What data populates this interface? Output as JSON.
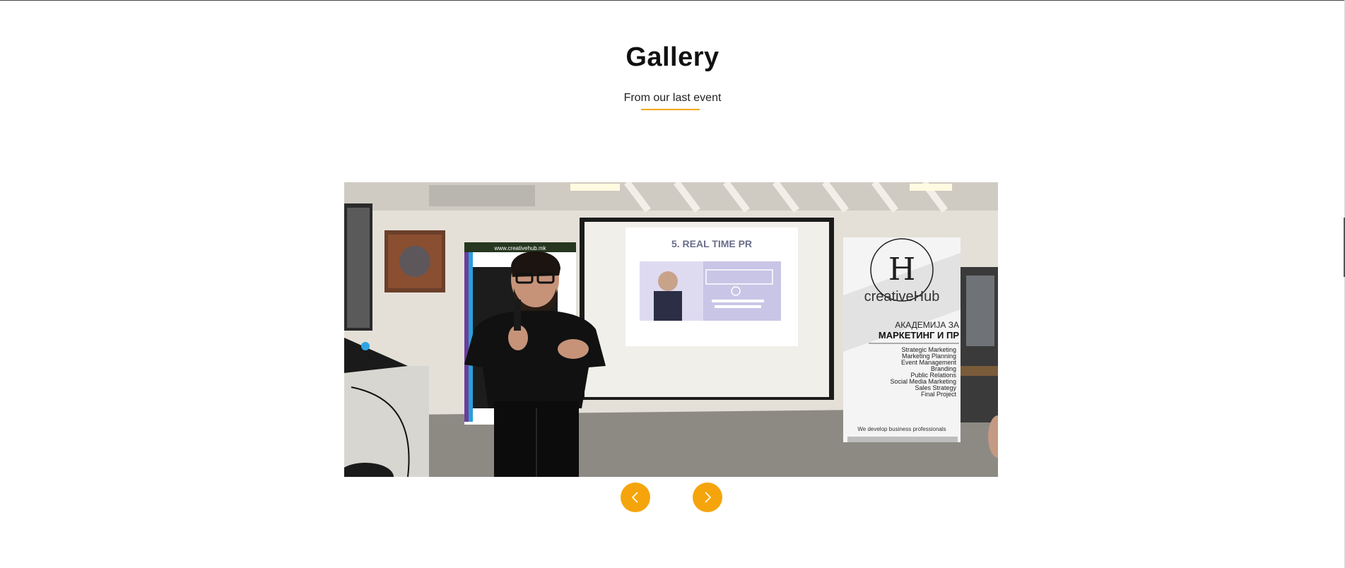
{
  "gallery": {
    "title": "Gallery",
    "subtitle": "From our last event",
    "image_alt": "Speaker presenting at a creativeHub event"
  },
  "slide": {
    "screen_heading": "5. REAL TIME PR",
    "banner_left_url": "www.creativehub.mk",
    "banner_right": {
      "logo_text": "creativeHub",
      "academy_line1": "АКАДЕМИЈА ЗА",
      "academy_line2": "МАРКЕТИНГ И ПР",
      "courses": [
        "Strategic Marketing",
        "Marketing Planning",
        "Event Management",
        "Branding",
        "Public Relations",
        "Social Media Marketing",
        "Sales Strategy",
        "Final Project"
      ],
      "tagline": "We develop business professionals"
    }
  },
  "carousel": {
    "prev_icon": "chevron-left-icon",
    "next_icon": "chevron-right-icon"
  },
  "colors": {
    "accent": "#f5a50b",
    "title": "#111111"
  }
}
